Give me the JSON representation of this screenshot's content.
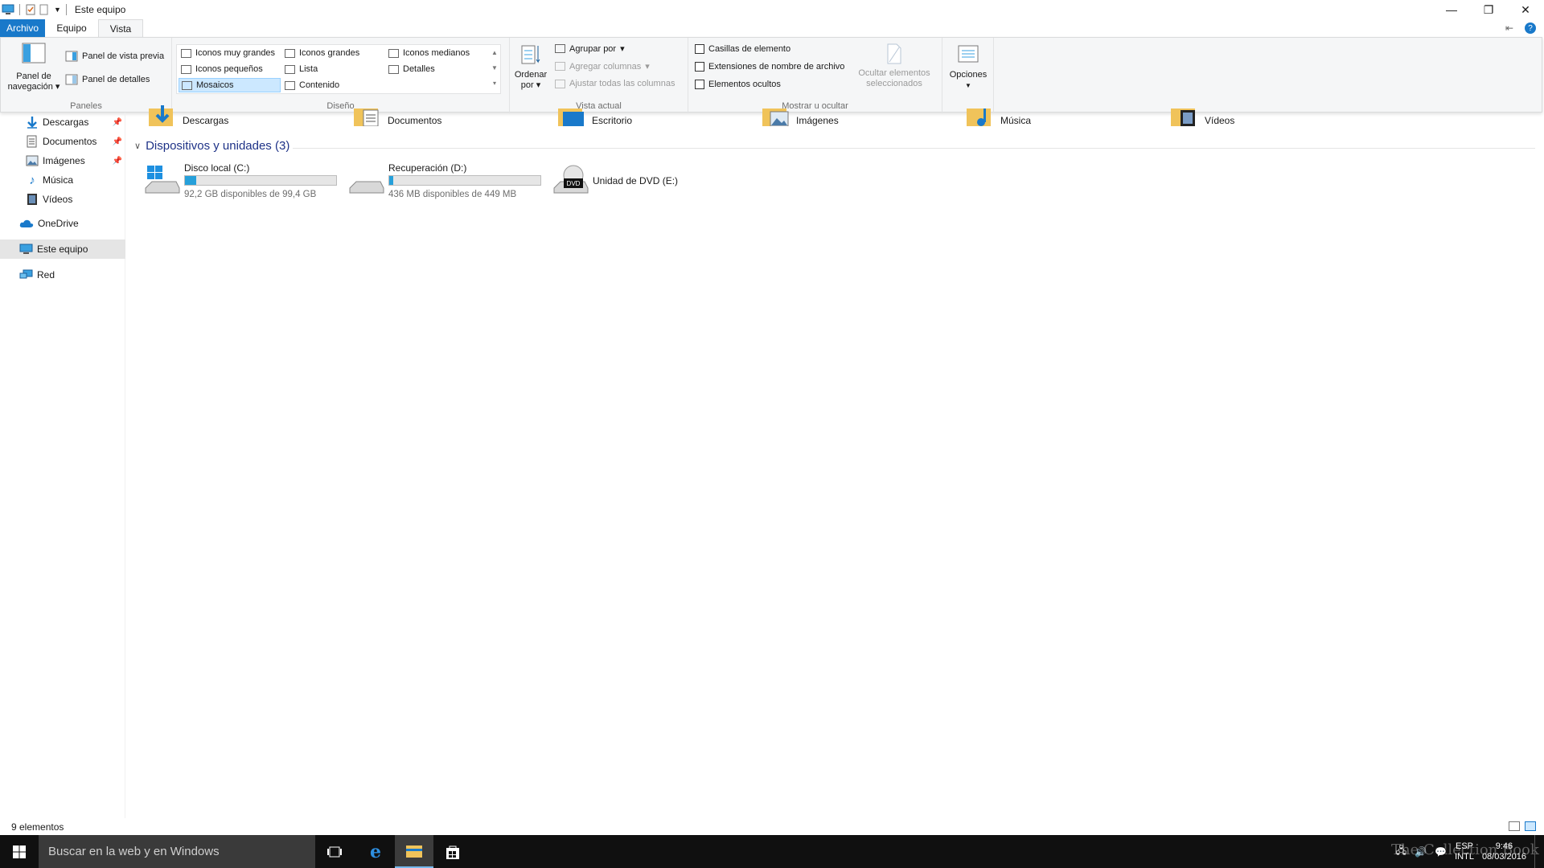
{
  "window": {
    "title": "Este equipo"
  },
  "tabs": [
    {
      "label": "Archivo"
    },
    {
      "label": "Equipo"
    },
    {
      "label": "Vista"
    }
  ],
  "ribbon": {
    "paneles": {
      "nav_pane_label": "Panel de navegación",
      "preview_pane": "Panel de vista previa",
      "details_pane": "Panel de detalles",
      "group_label": "Paneles"
    },
    "diseno": {
      "items": [
        "Iconos muy grandes",
        "Iconos grandes",
        "Iconos medianos",
        "Iconos pequeños",
        "Lista",
        "Detalles",
        "Mosaicos",
        "Contenido"
      ],
      "selected": "Mosaicos",
      "group_label": "Diseño"
    },
    "vista_actual": {
      "sort_by": "Ordenar por",
      "group_by": "Agrupar por",
      "add_columns": "Agregar columnas",
      "fit_columns": "Ajustar todas las columnas",
      "group_label": "Vista actual"
    },
    "mostrar": {
      "item_checkboxes": "Casillas de elemento",
      "extensions": "Extensiones de nombre de archivo",
      "hidden_items": "Elementos ocultos",
      "hide_selected": "Ocultar elementos seleccionados",
      "group_label": "Mostrar u ocultar"
    },
    "options": "Opciones"
  },
  "nav": {
    "items": [
      {
        "label": "Descargas",
        "pinned": true
      },
      {
        "label": "Documentos",
        "pinned": true
      },
      {
        "label": "Imágenes",
        "pinned": true
      },
      {
        "label": "Música",
        "pinned": false
      },
      {
        "label": "Vídeos",
        "pinned": false
      },
      {
        "label": "OneDrive",
        "pinned": false
      },
      {
        "label": "Este equipo",
        "pinned": false
      },
      {
        "label": "Red",
        "pinned": false
      }
    ],
    "selected": "Este equipo"
  },
  "folders": [
    "Descargas",
    "Documentos",
    "Escritorio",
    "Imágenes",
    "Música",
    "Vídeos"
  ],
  "devices": {
    "section_title": "Dispositivos y unidades (3)",
    "drives": [
      {
        "name": "Disco local (C:)",
        "free": "92,2 GB disponibles de 99,4 GB",
        "used_fraction": 0.072
      },
      {
        "name": "Recuperación (D:)",
        "free": "436 MB disponibles de 449 MB",
        "used_fraction": 0.029
      },
      {
        "name": "Unidad de DVD (E:)",
        "badge": "DVD"
      }
    ]
  },
  "status": {
    "count": "9 elementos"
  },
  "taskbar": {
    "search_placeholder": "Buscar en la web y en Windows",
    "lang_top": "ESP",
    "lang_bottom": "INTL",
    "time": "9:46",
    "date": "08/03/2016"
  },
  "watermark": "The Collection Book",
  "colors": {
    "accent": "#1979ca",
    "bar": "#26a0da",
    "taskbar": "#101010"
  }
}
